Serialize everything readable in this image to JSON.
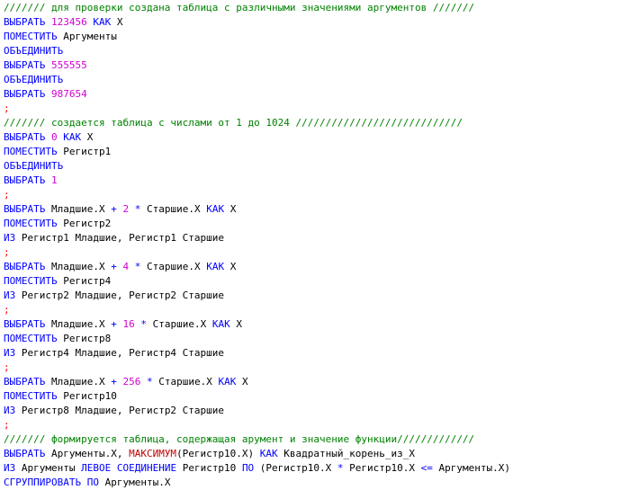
{
  "colors": {
    "comment": "#008000",
    "keyword": "#0000ff",
    "number": "#d000d0",
    "text": "#000000",
    "semicolon": "#ff0000",
    "function": "#c00000"
  },
  "lines": [
    [
      [
        "c",
        "/////// для проверки создана таблица с различными значениями аргументов ///////"
      ]
    ],
    [
      [
        "k",
        "ВЫБРАТЬ "
      ],
      [
        "n",
        "123456"
      ],
      [
        "t",
        " "
      ],
      [
        "k",
        "КАК"
      ],
      [
        "t",
        " X"
      ]
    ],
    [
      [
        "k",
        "ПОМЕСТИТЬ"
      ],
      [
        "t",
        " Аргументы"
      ]
    ],
    [
      [
        "k",
        "ОБЪЕДИНИТЬ"
      ]
    ],
    [
      [
        "k",
        "ВЫБРАТЬ "
      ],
      [
        "n",
        "555555"
      ]
    ],
    [
      [
        "k",
        "ОБЪЕДИНИТЬ"
      ]
    ],
    [
      [
        "k",
        "ВЫБРАТЬ "
      ],
      [
        "n",
        "987654"
      ]
    ],
    [
      [
        "s",
        ";"
      ]
    ],
    [
      [
        "c",
        "/////// создается таблица с числами от 1 до 1024 ////////////////////////////"
      ]
    ],
    [
      [
        "k",
        "ВЫБРАТЬ "
      ],
      [
        "n",
        "0"
      ],
      [
        "t",
        " "
      ],
      [
        "k",
        "КАК"
      ],
      [
        "t",
        " X"
      ]
    ],
    [
      [
        "k",
        "ПОМЕСТИТЬ"
      ],
      [
        "t",
        " Регистр1"
      ]
    ],
    [
      [
        "k",
        "ОБЪЕДИНИТЬ"
      ]
    ],
    [
      [
        "k",
        "ВЫБРАТЬ "
      ],
      [
        "n",
        "1"
      ]
    ],
    [
      [
        "s",
        ";"
      ]
    ],
    [
      [
        "k",
        "ВЫБРАТЬ"
      ],
      [
        "t",
        " Младшие.X "
      ],
      [
        "k",
        "+"
      ],
      [
        "t",
        " "
      ],
      [
        "n",
        "2"
      ],
      [
        "t",
        " "
      ],
      [
        "k",
        "*"
      ],
      [
        "t",
        " Старшие.X "
      ],
      [
        "k",
        "КАК"
      ],
      [
        "t",
        " X"
      ]
    ],
    [
      [
        "k",
        "ПОМЕСТИТЬ"
      ],
      [
        "t",
        " Регистр2"
      ]
    ],
    [
      [
        "k",
        "ИЗ"
      ],
      [
        "t",
        " Регистр1 Младшие, Регистр1 Старшие"
      ]
    ],
    [
      [
        "s",
        ";"
      ]
    ],
    [
      [
        "k",
        "ВЫБРАТЬ"
      ],
      [
        "t",
        " Младшие.X "
      ],
      [
        "k",
        "+"
      ],
      [
        "t",
        " "
      ],
      [
        "n",
        "4"
      ],
      [
        "t",
        " "
      ],
      [
        "k",
        "*"
      ],
      [
        "t",
        " Старшие.X "
      ],
      [
        "k",
        "КАК"
      ],
      [
        "t",
        " X"
      ]
    ],
    [
      [
        "k",
        "ПОМЕСТИТЬ"
      ],
      [
        "t",
        " Регистр4"
      ]
    ],
    [
      [
        "k",
        "ИЗ"
      ],
      [
        "t",
        " Регистр2 Младшие, Регистр2 Старшие"
      ]
    ],
    [
      [
        "s",
        ";"
      ]
    ],
    [
      [
        "k",
        "ВЫБРАТЬ"
      ],
      [
        "t",
        " Младшие.X "
      ],
      [
        "k",
        "+"
      ],
      [
        "t",
        " "
      ],
      [
        "n",
        "16"
      ],
      [
        "t",
        " "
      ],
      [
        "k",
        "*"
      ],
      [
        "t",
        " Старшие.X "
      ],
      [
        "k",
        "КАК"
      ],
      [
        "t",
        " X"
      ]
    ],
    [
      [
        "k",
        "ПОМЕСТИТЬ"
      ],
      [
        "t",
        " Регистр8"
      ]
    ],
    [
      [
        "k",
        "ИЗ"
      ],
      [
        "t",
        " Регистр4 Младшие, Регистр4 Старшие"
      ]
    ],
    [
      [
        "s",
        ";"
      ]
    ],
    [
      [
        "k",
        "ВЫБРАТЬ"
      ],
      [
        "t",
        " Младшие.X "
      ],
      [
        "k",
        "+"
      ],
      [
        "t",
        " "
      ],
      [
        "n",
        "256"
      ],
      [
        "t",
        " "
      ],
      [
        "k",
        "*"
      ],
      [
        "t",
        " Старшие.X "
      ],
      [
        "k",
        "КАК"
      ],
      [
        "t",
        " X"
      ]
    ],
    [
      [
        "k",
        "ПОМЕСТИТЬ"
      ],
      [
        "t",
        " Регистр10"
      ]
    ],
    [
      [
        "k",
        "ИЗ"
      ],
      [
        "t",
        " Регистр8 Младшие, Регистр2 Старшие"
      ]
    ],
    [
      [
        "s",
        ";"
      ]
    ],
    [
      [
        "c",
        "/////// формируется таблица, содержащая арумент и значение функции/////////////"
      ]
    ],
    [
      [
        "k",
        "ВЫБРАТЬ"
      ],
      [
        "t",
        " Аргументы.X, "
      ],
      [
        "f",
        "МАКСИМУМ"
      ],
      [
        "t",
        "(Регистр10.X) "
      ],
      [
        "k",
        "КАК"
      ],
      [
        "t",
        " Квадратный_корень_из_X"
      ]
    ],
    [
      [
        "k",
        "ИЗ"
      ],
      [
        "t",
        " Аргументы "
      ],
      [
        "k",
        "ЛЕВОЕ СОЕДИНЕНИЕ"
      ],
      [
        "t",
        " Регистр10 "
      ],
      [
        "k",
        "ПО"
      ],
      [
        "t",
        " (Регистр10.X "
      ],
      [
        "k",
        "*"
      ],
      [
        "t",
        " Регистр10.X "
      ],
      [
        "k",
        "<="
      ],
      [
        "t",
        " Аргументы.X)"
      ]
    ],
    [
      [
        "k",
        "СГРУППИРОВАТЬ ПО"
      ],
      [
        "t",
        " Аргументы.X"
      ]
    ]
  ]
}
